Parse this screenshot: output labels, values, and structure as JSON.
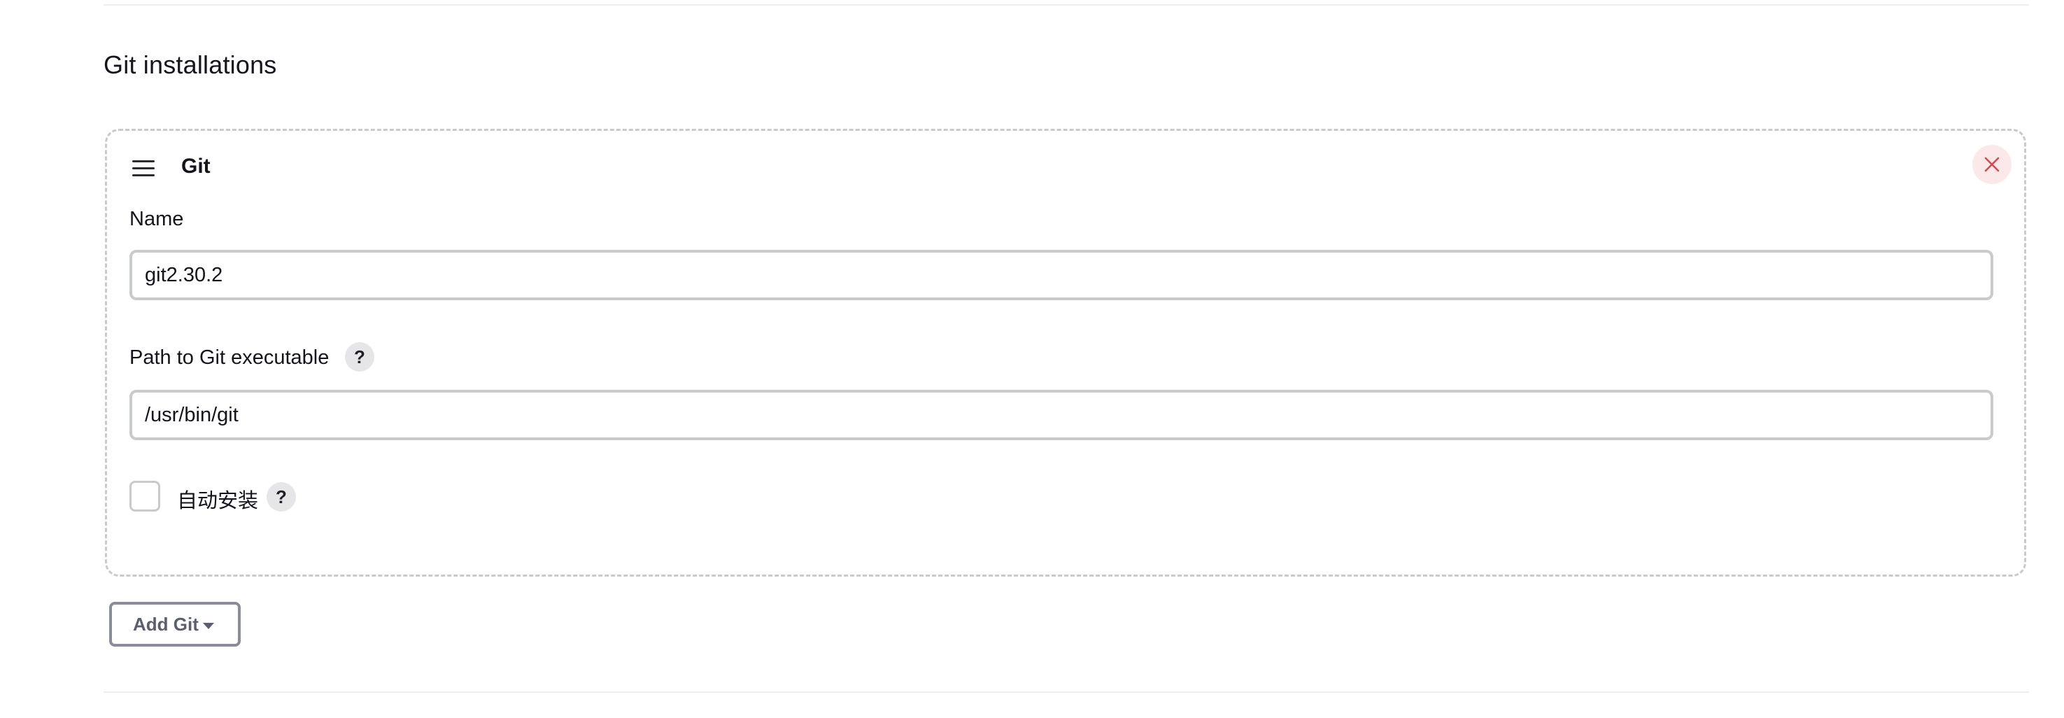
{
  "section": {
    "title": "Git installations"
  },
  "installation": {
    "title": "Git",
    "name_label": "Name",
    "name_value": "git2.30.2",
    "path_label": "Path to Git executable",
    "path_value": "/usr/bin/git",
    "auto_install_label": "自动安装",
    "auto_install_checked": false,
    "help_glyph": "?"
  },
  "actions": {
    "add_label": "Add Git"
  },
  "icons": {
    "drag": "drag-handle-icon",
    "delete": "close-icon",
    "help": "help-icon",
    "caret": "caret-down-icon"
  },
  "colors": {
    "delete_icon": "#d24b4e",
    "delete_bg": "#fbe9ea",
    "border": "#c9cacc",
    "button_border": "#8a8d99"
  }
}
